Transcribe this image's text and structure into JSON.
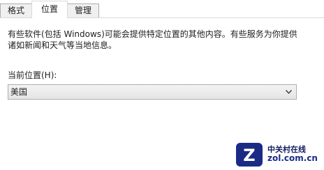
{
  "tabs": [
    {
      "label": "格式",
      "active": false
    },
    {
      "label": "位置",
      "active": true
    },
    {
      "label": "管理",
      "active": false
    }
  ],
  "content": {
    "description_line1": "有些软件(包括 Windows)可能会提供特定位置的其他内容。有些服务为你提供",
    "description_line2": "诸如新闻和天气等当地信息。",
    "location_label": "当前位置(H):",
    "location_select": {
      "value": "美国"
    }
  },
  "watermark": {
    "name": "中关村在线",
    "domain": "zol.com.cn",
    "badge_letter": "Z",
    "color": "#1a2b86"
  },
  "icons": {
    "select_arrow": "chevron-down-icon"
  }
}
